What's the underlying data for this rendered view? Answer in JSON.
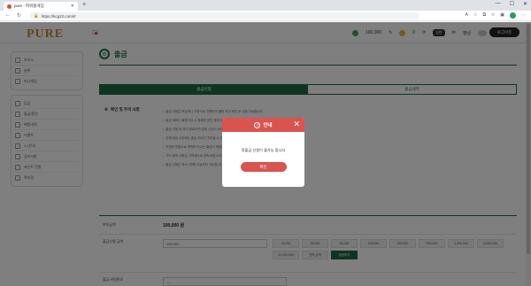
{
  "browser": {
    "tab_title": "pure - 파워볼게임",
    "url": "https://kcg22.com/#"
  },
  "site": {
    "logo": "PURE",
    "header": {
      "balance_a": "100,000",
      "balance_b": "0",
      "level": "일반",
      "user": "영상",
      "logout": "로그아웃"
    },
    "sidebar": {
      "group1": [
        "카지노",
        "슬롯",
        "미니게임"
      ],
      "group2": [
        "입금",
        "출금/환전",
        "베팅내역",
        "이벤트",
        "1:1문의",
        "공지사항",
        "포인트 전환",
        "쪽지함"
      ]
    }
  },
  "main": {
    "page_title": "출금",
    "tabs": [
      "출금신청",
      "출금내역"
    ],
    "notice_title": "확인 및 주의 사항",
    "notice_items": [
      "출금 신청은 보유머니 기준으로 진행되며 롤링 조건 확인 후 신청 가능합니다.",
      "출금 계좌는 회원가입 시 등록한 본인 명의 계좌로만 출금됩니다.",
      "출금 신청 후 처리 완료까지 일정 시간이 소요될 수 있습니다.",
      "은행 점검 시간에는 출금 처리가 지연될 수 있습니다.",
      "부정한 방법으로 획득한 머니는 출금이 제한됩니다.",
      "기타 문의 사항은 고객센터로 연락 바랍니다.",
      "출금 신청은 최소 1만원 이상부터 가능합니다."
    ],
    "form": {
      "balance_label": "보유금액",
      "balance_value": "100,000 원",
      "amount_label": "출금신청 금액",
      "amount_value": "100,000",
      "chips": [
        "10,000",
        "30,000",
        "50,000",
        "100,000",
        "300,000",
        "500,000",
        "1,000,000",
        "3,000,000",
        "10,000,000",
        "전체 금액",
        "정정하기"
      ],
      "password_label": "출금 비밀번호",
      "password_value": "----"
    }
  },
  "modal": {
    "title": "안내",
    "message": "정출금 신청이 불가능 합니다",
    "confirm": "확인"
  }
}
